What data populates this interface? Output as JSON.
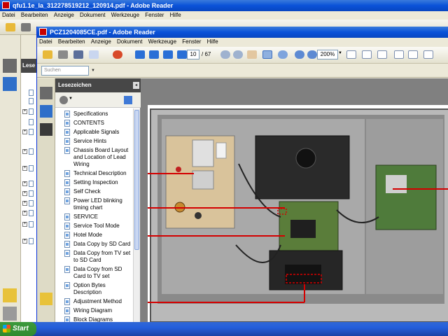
{
  "back_window": {
    "title": "qfu1.1e_la_312278519212_120914.pdf - Adobe Reader",
    "menu": [
      "Datei",
      "Bearbeiten",
      "Anzeige",
      "Dokument",
      "Werkzeuge",
      "Fenster",
      "Hilfe"
    ],
    "side_label": "Lese"
  },
  "front_window": {
    "title": "PCZ1204085CE.pdf - Adobe Reader",
    "menu": [
      "Datei",
      "Bearbeiten",
      "Anzeige",
      "Dokument",
      "Werkzeuge",
      "Fenster",
      "Hilfe"
    ],
    "page_current": "10",
    "page_total": "/ 67",
    "zoom": "200%",
    "search_placeholder": "Suchen"
  },
  "bookmarks": {
    "title": "Lesezeichen",
    "items": [
      "Specifications",
      "CONTENTS",
      "Applicable Signals",
      "Service Hints",
      "Chassis Board Layout and Location of Lead Wiring",
      "Technical Description",
      "Setting Inspection",
      "Self Check",
      "Power LED blinking timing chart",
      "SERVICE",
      "Service Tool Mode",
      "Hotel Mode",
      "Data Copy by SD Card",
      "Data Copy from TV set to SD Card",
      "Data Copy from SD Card to TV set",
      "Option Bytes Description",
      "Adjustment Method",
      "Wiring Diagram",
      "Block Diagrams"
    ]
  },
  "taskbar": {
    "start_label": "Start"
  },
  "colors": {
    "title_blue": "#0a52d8",
    "callout_red": "#d40000",
    "bookmark_header": "#474747"
  }
}
